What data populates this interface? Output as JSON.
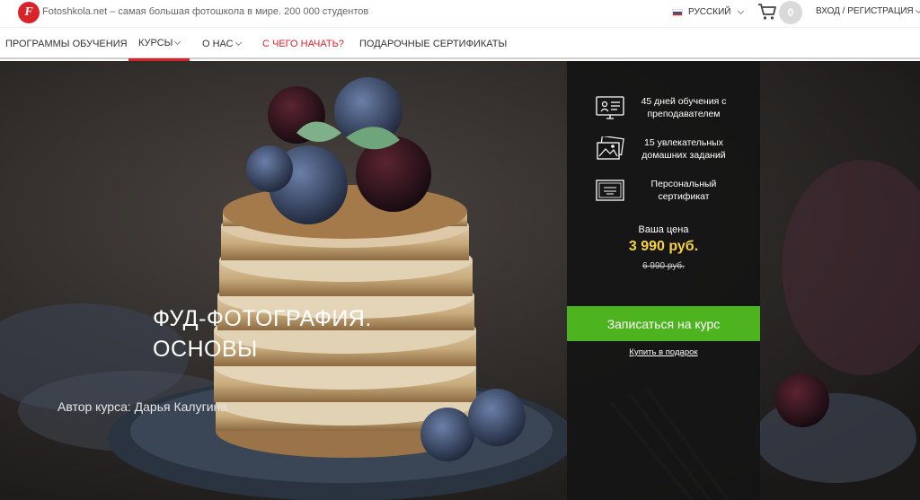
{
  "header": {
    "logo_letter": "F",
    "tagline": "Fotoshkola.net – самая большая фотошкола в мире. 200 000 студентов",
    "language": "РУССКИЙ",
    "cart_count": "0",
    "login": "ВХОД / РЕГИСТРАЦИЯ",
    "flag_colors": [
      "#ffffff",
      "#1c57a8",
      "#d52b1e"
    ],
    "brand_color": "#d8232a"
  },
  "nav": {
    "items": [
      {
        "label": "ПРОГРАММЫ ОБУЧЕНИЯ"
      },
      {
        "label": "КУРСЫ"
      },
      {
        "label": "О НАС"
      },
      {
        "label": "С ЧЕГО НАЧАТЬ?"
      },
      {
        "label": "ПОДАРОЧНЫЕ СЕРТИФИКАТЫ"
      }
    ]
  },
  "hero": {
    "title_line1": "ФУД-ФОТОГРАФИЯ.",
    "title_line2": "ОСНОВЫ",
    "author": "Автор курса: Дарья Калугина"
  },
  "panel": {
    "features": [
      {
        "icon": "monitor-teacher-icon",
        "text": "45 дней обучения с преподавателем"
      },
      {
        "icon": "photos-icon",
        "text": "15 увлекательных домашних заданий"
      },
      {
        "icon": "certificate-icon",
        "text": "Персональный сертификат"
      }
    ],
    "price_label": "Ваша цена",
    "price_new": "3 990 руб.",
    "price_old": "6 990 руб.",
    "enroll_button": "Записаться на курс",
    "gift_link": "Купить в подарок",
    "accent_green": "#4db31f",
    "price_yellow": "#f7d23e"
  }
}
